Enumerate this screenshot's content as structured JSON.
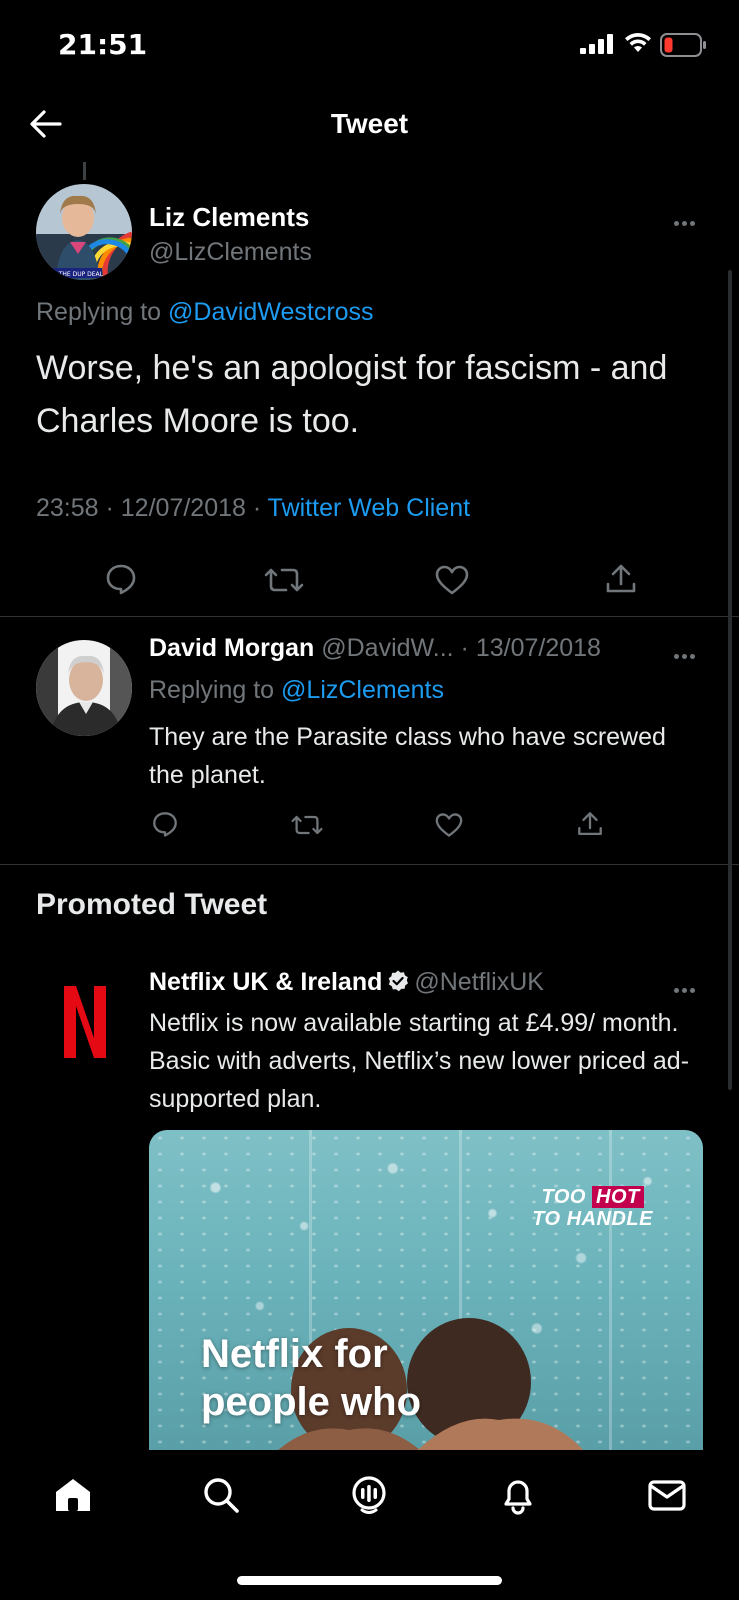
{
  "status_bar": {
    "time": "21:51"
  },
  "header": {
    "title": "Tweet"
  },
  "main_tweet": {
    "author_name": "Liz Clements",
    "author_handle": "@LizClements",
    "replying_label": "Replying to",
    "replying_to": "@DavidWestcross",
    "text": "Worse, he's an apologist for fascism - and Charles Moore is too.",
    "time": "23:58",
    "date": "12/07/2018",
    "source": "Twitter Web Client",
    "avatar_text": "STOP THE DUP DEAL"
  },
  "reply_tweet": {
    "author_name": "David Morgan",
    "author_handle": "@DavidW...",
    "date": "13/07/2018",
    "replying_label": "Replying to",
    "replying_to": "@LizClements",
    "text": "They are the Parasite class who have screwed the planet."
  },
  "promoted": {
    "section_title": "Promoted Tweet",
    "author_name": "Netflix UK & Ireland",
    "author_handle": "@NetflixUK",
    "logo_letter": "N",
    "text": "Netflix is now available starting at £4.99/ month. Basic with adverts, Netflix’s new lower priced ad-supported plan.",
    "media": {
      "badge_line1_a": "TOO",
      "badge_line1_b": "HOT",
      "badge_line2": "TO HANDLE",
      "caption_line1": "Netflix for",
      "caption_line2": "people who"
    }
  },
  "colors": {
    "background": "#000000",
    "link": "#1d9bf0",
    "muted": "#71767b",
    "netflix_red": "#e50914",
    "battery_low": "#ff3b30"
  },
  "nav": [
    "home-icon",
    "search-icon",
    "spaces-icon",
    "notifications-icon",
    "messages-icon"
  ]
}
